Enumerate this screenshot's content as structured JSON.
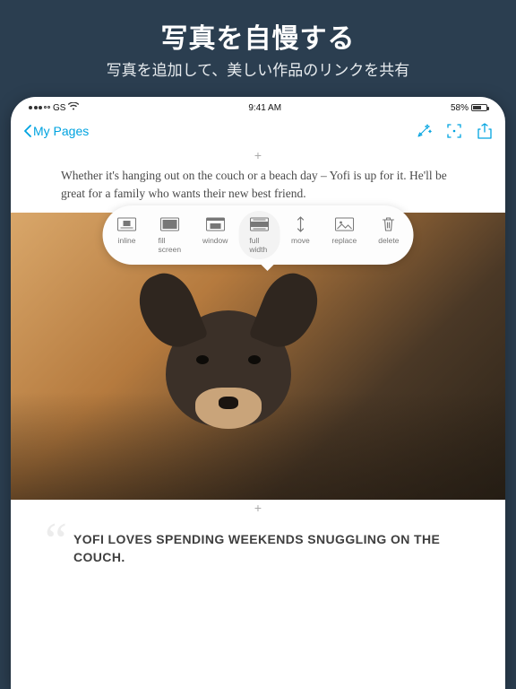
{
  "promo": {
    "title": "写真を自慢する",
    "subtitle": "写真を追加して、美しい作品のリンクを共有"
  },
  "status_bar": {
    "carrier": "GS",
    "time": "9:41 AM",
    "battery_pct": "58%"
  },
  "nav": {
    "back_label": "My Pages"
  },
  "content": {
    "body_text": "Whether it's hanging out on the couch or a beach day – Yofi is up for it. He'll be great for a family who wants their new best friend.",
    "add_button": "+",
    "quote": "YOFI LOVES SPENDING WEEKENDS SNUGGLING ON THE COUCH."
  },
  "image_toolbar": {
    "items": [
      {
        "label": "inline"
      },
      {
        "label": "fill screen"
      },
      {
        "label": "window"
      },
      {
        "label": "full width"
      },
      {
        "label": "move"
      },
      {
        "label": "replace"
      },
      {
        "label": "delete"
      }
    ],
    "active_index": 3
  }
}
